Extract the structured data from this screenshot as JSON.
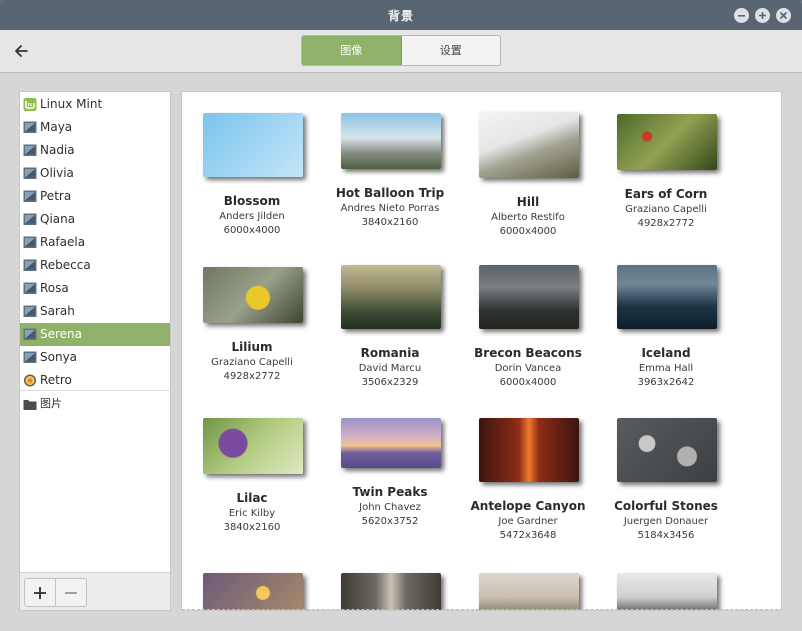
{
  "window": {
    "title": "背景"
  },
  "header": {
    "tabs": [
      "图像",
      "设置"
    ],
    "active_tab": 0
  },
  "sidebar": {
    "items": [
      {
        "label": "Linux Mint",
        "icon": "linux-mint-icon"
      },
      {
        "label": "Maya",
        "icon": "wallpaper-collection-icon"
      },
      {
        "label": "Nadia",
        "icon": "wallpaper-collection-icon"
      },
      {
        "label": "Olivia",
        "icon": "wallpaper-collection-icon"
      },
      {
        "label": "Petra",
        "icon": "wallpaper-collection-icon"
      },
      {
        "label": "Qiana",
        "icon": "wallpaper-collection-icon"
      },
      {
        "label": "Rafaela",
        "icon": "wallpaper-collection-icon"
      },
      {
        "label": "Rebecca",
        "icon": "wallpaper-collection-icon"
      },
      {
        "label": "Rosa",
        "icon": "wallpaper-collection-icon"
      },
      {
        "label": "Sarah",
        "icon": "wallpaper-collection-icon"
      },
      {
        "label": "Serena",
        "icon": "wallpaper-collection-icon",
        "selected": true
      },
      {
        "label": "Sonya",
        "icon": "wallpaper-collection-icon"
      },
      {
        "label": "Retro",
        "icon": "retro-icon"
      }
    ],
    "folders": [
      {
        "label": "图片",
        "icon": "folder-icon"
      }
    ]
  },
  "wallpapers": [
    {
      "title": "Blossom",
      "author": "Anders Jilden",
      "size": "6000x4000"
    },
    {
      "title": "Hot Balloon Trip",
      "author": "Andres Nieto Porras",
      "size": "3840x2160"
    },
    {
      "title": "Hill",
      "author": "Alberto Restifo",
      "size": "6000x4000"
    },
    {
      "title": "Ears of Corn",
      "author": "Graziano Capelli",
      "size": "4928x2772"
    },
    {
      "title": "Lilium",
      "author": "Graziano Capelli",
      "size": "4928x2772"
    },
    {
      "title": "Romania",
      "author": "David Marcu",
      "size": "3506x2329"
    },
    {
      "title": "Brecon Beacons",
      "author": "Dorin Vancea",
      "size": "6000x4000"
    },
    {
      "title": "Iceland",
      "author": "Emma Hall",
      "size": "3963x2642"
    },
    {
      "title": "Lilac",
      "author": "Eric Kilby",
      "size": "3840x2160"
    },
    {
      "title": "Twin Peaks",
      "author": "John Chavez",
      "size": "5620x3752"
    },
    {
      "title": "Antelope Canyon",
      "author": "Joe Gardner",
      "size": "5472x3648"
    },
    {
      "title": "Colorful Stones",
      "author": "Juergen Donauer",
      "size": "5184x3456"
    }
  ],
  "colors": {
    "accent": "#8fb16a",
    "titlebar": "#596573"
  }
}
